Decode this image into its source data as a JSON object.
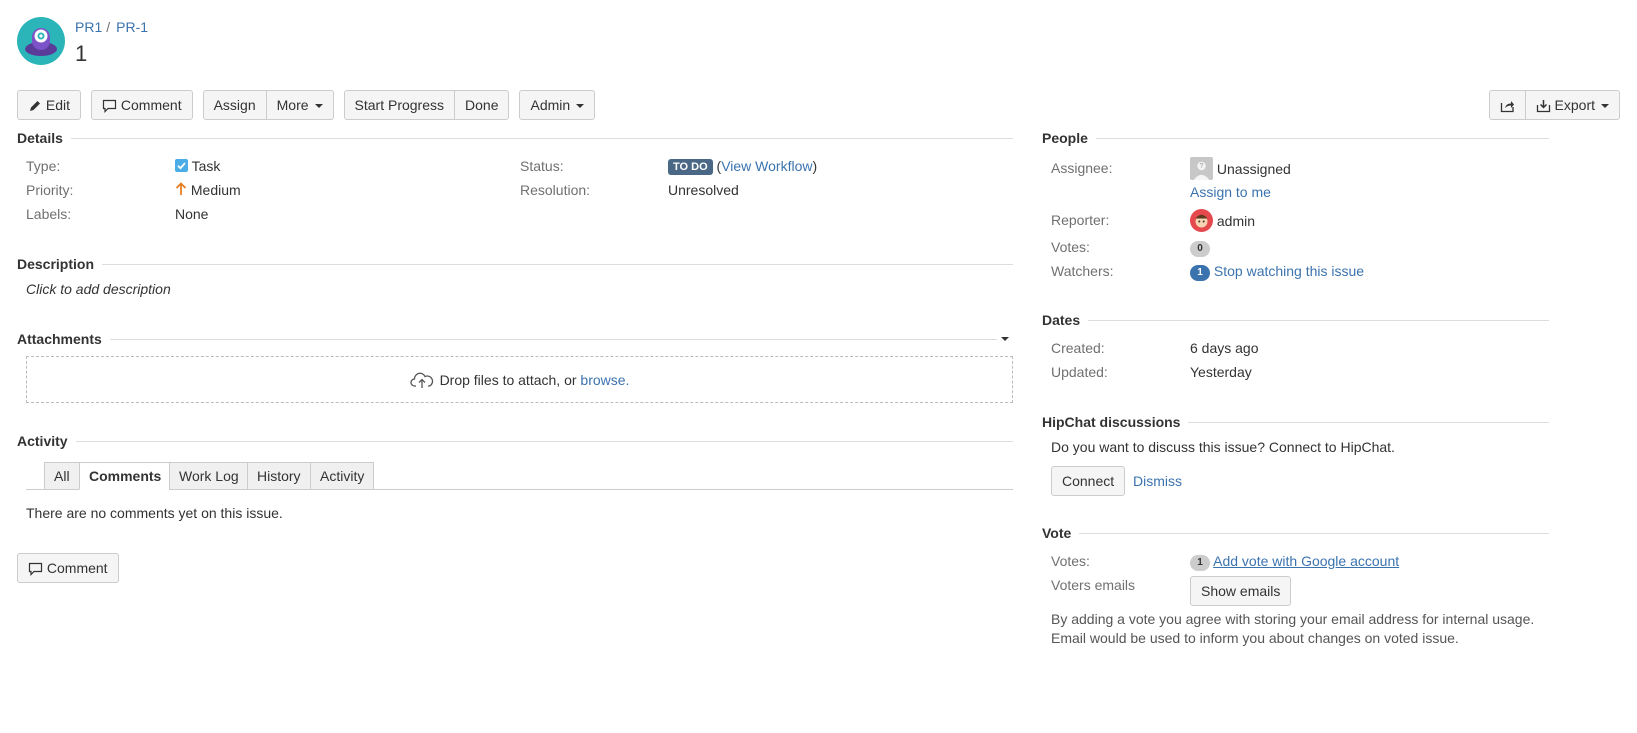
{
  "breadcrumb": {
    "project": "PR1",
    "separator": "/",
    "issue_key": "PR-1"
  },
  "issue": {
    "title": "1"
  },
  "toolbar": {
    "edit": "Edit",
    "comment": "Comment",
    "assign": "Assign",
    "more": "More",
    "start_progress": "Start Progress",
    "done": "Done",
    "admin": "Admin",
    "export": "Export"
  },
  "details": {
    "heading": "Details",
    "type_label": "Type:",
    "type_value": "Task",
    "priority_label": "Priority:",
    "priority_value": "Medium",
    "labels_label": "Labels:",
    "labels_value": "None",
    "status_label": "Status:",
    "status_value": "TO DO",
    "status_paren_open": "(",
    "view_workflow": "View Workflow",
    "status_paren_close": ")",
    "resolution_label": "Resolution:",
    "resolution_value": "Unresolved"
  },
  "description": {
    "heading": "Description",
    "placeholder": "Click to add description"
  },
  "attachments": {
    "heading": "Attachments",
    "drop_text": "Drop files to attach, or",
    "browse": "browse."
  },
  "activity": {
    "heading": "Activity",
    "tabs": [
      "All",
      "Comments",
      "Work Log",
      "History",
      "Activity"
    ],
    "active_tab": "Comments",
    "empty": "There are no comments yet on this issue.",
    "comment_button": "Comment"
  },
  "people": {
    "heading": "People",
    "assignee_label": "Assignee:",
    "assignee_value": "Unassigned",
    "assign_to_me": "Assign to me",
    "reporter_label": "Reporter:",
    "reporter_value": "admin",
    "votes_label": "Votes:",
    "votes_count": "0",
    "watchers_label": "Watchers:",
    "watchers_count": "1",
    "stop_watching": "Stop watching this issue"
  },
  "dates": {
    "heading": "Dates",
    "created_label": "Created:",
    "created_value": "6 days ago",
    "updated_label": "Updated:",
    "updated_value": "Yesterday"
  },
  "hipchat": {
    "heading": "HipChat discussions",
    "prompt": "Do you want to discuss this issue? Connect to HipChat.",
    "connect": "Connect",
    "dismiss": "Dismiss"
  },
  "vote": {
    "heading": "Vote",
    "votes_label": "Votes:",
    "votes_count": "1",
    "add_vote": "Add vote with Google account",
    "emails_label": "Voters emails",
    "show_emails": "Show emails",
    "note_line1": "By adding a vote you agree with storing your email address for internal usage.",
    "note_line2": "Email would be used to inform you about changes on voted issue."
  },
  "colors": {
    "link": "#3b73af",
    "status_lozenge": "#4a6785",
    "priority_medium": "#e67e22",
    "task_icon": "#4bade8"
  },
  "icons": [
    "project-avatar",
    "pencil-icon",
    "comment-icon",
    "share-icon",
    "export-icon",
    "task-checkbox-icon",
    "priority-medium-arrow-icon",
    "cloud-upload-icon",
    "unassigned-avatar-icon",
    "admin-avatar-icon",
    "collapse-caret-icon"
  ]
}
